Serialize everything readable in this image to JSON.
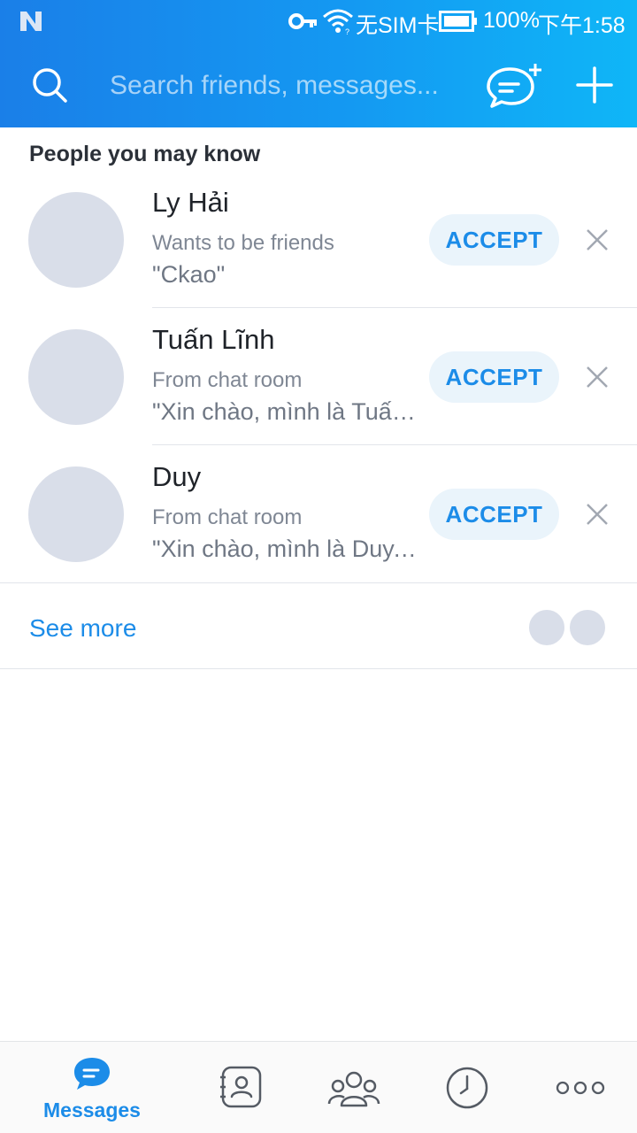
{
  "status_bar": {
    "sim": "无SIM卡",
    "battery": "100%",
    "time": "下午1:58"
  },
  "header": {
    "search_placeholder": "Search friends, messages..."
  },
  "section_title": "People you may know",
  "suggestions": [
    {
      "name": "Ly Hải",
      "subtitle": "Wants to be friends",
      "message": "\"Ckao\"",
      "accept_label": "ACCEPT"
    },
    {
      "name": "Tuấn Lĩnh",
      "subtitle": "From chat room",
      "message": "\"Xin chào, mình là Tuấn Lĩnh\"",
      "accept_label": "ACCEPT"
    },
    {
      "name": "Duy",
      "subtitle": "From chat room",
      "message": "\"Xin chào, mình là Duy....\"",
      "accept_label": "ACCEPT"
    }
  ],
  "see_more": "See more",
  "bottom_nav": [
    {
      "label": "Messages",
      "icon": "chat-bubble-icon",
      "active": true
    },
    {
      "label": "",
      "icon": "contacts-icon",
      "active": false
    },
    {
      "label": "",
      "icon": "group-icon",
      "active": false
    },
    {
      "label": "",
      "icon": "clock-icon",
      "active": false
    },
    {
      "label": "",
      "icon": "more-icon",
      "active": false
    }
  ],
  "colors": {
    "accent": "#1c8ce8",
    "header_gradient_start": "#1a7fe8",
    "header_gradient_end": "#0fb6f7",
    "avatar_placeholder": "#d9dee9",
    "accept_button_bg": "#eaf4fb"
  }
}
